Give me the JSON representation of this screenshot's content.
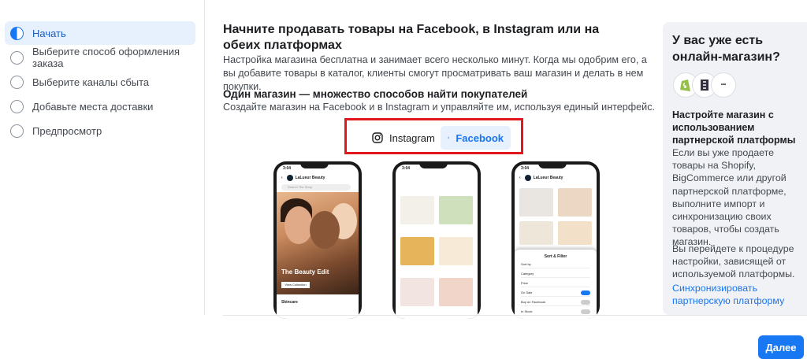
{
  "nav": {
    "steps": [
      {
        "label": "Начать",
        "active": true
      },
      {
        "label": "Выберите способ оформления заказа",
        "active": false
      },
      {
        "label": "Выберите каналы сбыта",
        "active": false
      },
      {
        "label": "Добавьте места доставки",
        "active": false
      },
      {
        "label": "Предпросмотр",
        "active": false
      }
    ]
  },
  "main": {
    "title": "Начните продавать товары на Facebook, в Instagram или на обеих платформах",
    "subtitle": "Настройка магазина бесплатна и занимает всего несколько минут. Когда мы одобрим его, а вы добавите товары в каталог, клиенты смогут просматривать ваш магазин и делать в нем покупки.",
    "heading": "Один магазин — множество способов найти покупателей",
    "description": "Создайте магазин на Facebook и в Instagram и управляйте им, используя единый интерфейс.",
    "toggle": {
      "instagram_label": "Instagram",
      "facebook_label": "Facebook",
      "selected": "Facebook"
    },
    "phones": {
      "time": "3:04",
      "shop_name": "LaLueur Beauty",
      "search_placeholder": "Search The Shop",
      "hero_title": "The Beauty Edit",
      "hero_button": "View Collection",
      "category": "Skincare",
      "sort_title": "Sort & Filter",
      "sort_rows": [
        "Sort by",
        "Category",
        "Price",
        "On Sale",
        "Buy on Facebook",
        "In Stock"
      ]
    }
  },
  "side": {
    "title": "У вас уже есть онлайн-магазин?",
    "logos": [
      "shopify-logo",
      "bigcommerce-logo",
      "other-partner-logo"
    ],
    "heading": "Настройте магазин с использованием партнерской платформы",
    "paragraph1": "Если вы уже продаете товары на Shopify, BigCommerce или другой партнерской платформе, выполните импорт и синхронизацию своих товаров, чтобы создать магазин.",
    "paragraph2": "Вы перейдете к процедуре настройки, зависящей от используемой платформы.",
    "link": "Синхронизировать партнерскую платформу"
  },
  "footer": {
    "next_label": "Далее"
  },
  "colors": {
    "accent": "#1877f2",
    "highlight_border": "#e0181b",
    "active_bg": "#e7f0fd"
  }
}
